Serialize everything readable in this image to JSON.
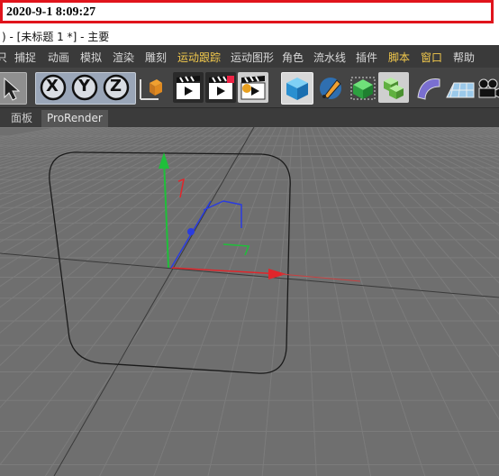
{
  "timestamp": "2020-9-1 8:09:27",
  "window": {
    "title": ") - [未标题 1 *] - 主要"
  },
  "menu": {
    "items": [
      "只",
      "捕捉",
      "动画",
      "模拟",
      "渲染",
      "雕刻",
      "运动跟踪",
      "运动图形",
      "角色",
      "流水线",
      "插件",
      "脚本",
      "窗口",
      "帮助"
    ],
    "highlighted": [
      "运动跟踪",
      "脚本",
      "窗口"
    ]
  },
  "toolbar": {
    "icons": [
      "select-arrow-icon",
      "x-axis-lock-icon",
      "y-axis-lock-icon",
      "z-axis-lock-icon",
      "coordinate-system-icon",
      "render-view-icon",
      "render-picture-icon",
      "render-settings-icon",
      "cube-primitive-icon",
      "pen-spline-icon",
      "subdivision-surface-icon",
      "array-generator-icon",
      "deformer-bend-icon",
      "floor-plane-icon",
      "camera-icon"
    ],
    "axis_labels": [
      "X",
      "Y",
      "Z"
    ]
  },
  "panel": {
    "tabs": [
      "面板",
      "ProRender"
    ],
    "active_tab": "ProRender"
  },
  "colors": {
    "highlight_menu": "#f2c94c",
    "timestamp_border": "#e0141c",
    "x_axis": "#e0262b",
    "y_axis": "#1fbf3a",
    "z_axis": "#2a3ce0"
  }
}
